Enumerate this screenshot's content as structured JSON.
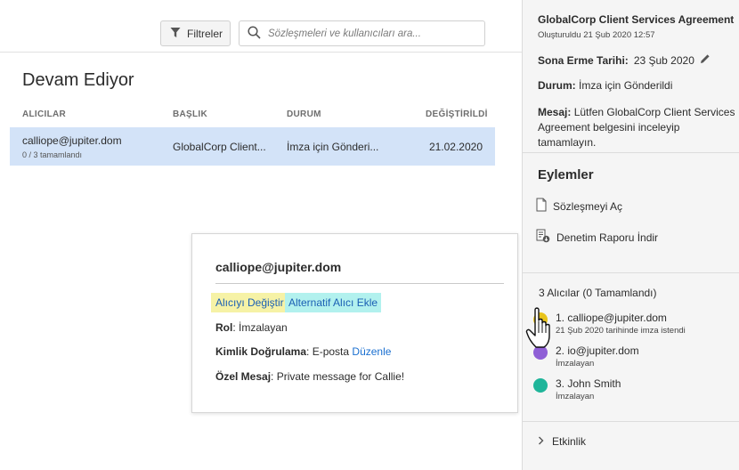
{
  "toolbar": {
    "filter_label": "Filtreler",
    "search_placeholder": "Sözleşmeleri ve kullanıcıları ara..."
  },
  "list": {
    "section_title": "Devam Ediyor",
    "columns": [
      "ALICILAR",
      "BAŞLIK",
      "DURUM",
      "DEĞİŞTİRİLDİ"
    ],
    "rows": [
      {
        "recipient": "calliope@jupiter.dom",
        "progress": "0 / 3 tamamlandı",
        "title": "GlobalCorp Client...",
        "status": "İmza için Gönderi...",
        "modified": "21.02.2020"
      }
    ]
  },
  "popup": {
    "email": "calliope@jupiter.dom",
    "change_recipient": "Alıcıyı Değiştir",
    "add_alternate": "Alternatif Alıcı Ekle",
    "role_label": "Rol",
    "role_value": ": İmzalayan",
    "auth_label": "Kimlik Doğrulama",
    "auth_value": ": E-posta",
    "edit_link": "Düzenle",
    "message_label": "Özel Mesaj",
    "message_value": ": Private message for Callie!"
  },
  "panel": {
    "agreement_title": "GlobalCorp Client Services Agreement",
    "created": "Oluşturuldu 21 Şub 2020 12:57",
    "expiration_label": "Sona Erme Tarihi:",
    "expiration_value": "23 Şub 2020",
    "status_label": "Durum:",
    "status_value": "İmza için Gönderildi",
    "message_label": "Mesaj:",
    "message_value": "Lütfen GlobalCorp Client Services Agreement belgesini inceleyip tamamlayın.",
    "actions_title": "Eylemler",
    "actions": [
      "Sözleşmeyi Aç",
      "Denetim Raporu İndir"
    ],
    "recipients_header": "3 Alıcılar (0 Tamamlandı)",
    "recipients": [
      {
        "name": "1. calliope@jupiter.dom",
        "sub": "21 Şub 2020 tarihinde imza istendi",
        "color": "#e8c31a"
      },
      {
        "name": "2. io@jupiter.dom",
        "sub": "İmzalayan",
        "color": "#8f5fd6"
      },
      {
        "name": "3. John Smith",
        "sub": "İmzalayan",
        "color": "#1fb59a"
      }
    ],
    "activity_label": "Etkinlik"
  },
  "colors": {
    "selected_row": "#d3e3f8",
    "highlight_yellow": "#f6f2a6",
    "highlight_cyan": "#b2f1ee",
    "link_blue": "#1a6fd0"
  }
}
